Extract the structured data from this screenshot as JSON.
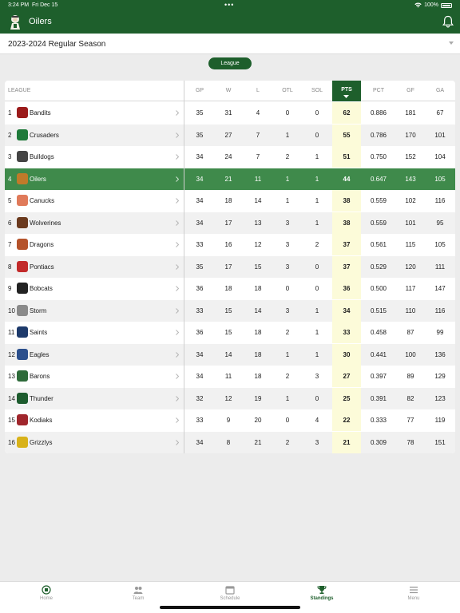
{
  "status_bar": {
    "time": "3:24 PM",
    "date": "Fri Dec 15",
    "battery": "100%"
  },
  "header": {
    "team_name": "Oilers"
  },
  "season": {
    "selected": "2023-2024 Regular Season"
  },
  "filter": {
    "label": "League"
  },
  "table": {
    "columns": [
      "LEAGUE",
      "GP",
      "W",
      "L",
      "OTL",
      "SOL",
      "PTS",
      "PCT",
      "GF",
      "GA"
    ],
    "sorted_column": "PTS",
    "selected_row": 3,
    "rows": [
      {
        "rank": "1",
        "team": "Bandits",
        "gp": "35",
        "w": "31",
        "l": "4",
        "otl": "0",
        "sol": "0",
        "pts": "62",
        "pct": "0.886",
        "gf": "181",
        "ga": "67",
        "logo_color": "#9b1b1b"
      },
      {
        "rank": "2",
        "team": "Crusaders",
        "gp": "35",
        "w": "27",
        "l": "7",
        "otl": "1",
        "sol": "0",
        "pts": "55",
        "pct": "0.786",
        "gf": "170",
        "ga": "101",
        "logo_color": "#1f7a3a"
      },
      {
        "rank": "3",
        "team": "Bulldogs",
        "gp": "34",
        "w": "24",
        "l": "7",
        "otl": "2",
        "sol": "1",
        "pts": "51",
        "pct": "0.750",
        "gf": "152",
        "ga": "104",
        "logo_color": "#444444"
      },
      {
        "rank": "4",
        "team": "Oilers",
        "gp": "34",
        "w": "21",
        "l": "11",
        "otl": "1",
        "sol": "1",
        "pts": "44",
        "pct": "0.647",
        "gf": "143",
        "ga": "105",
        "logo_color": "#c07a2a"
      },
      {
        "rank": "5",
        "team": "Canucks",
        "gp": "34",
        "w": "18",
        "l": "14",
        "otl": "1",
        "sol": "1",
        "pts": "38",
        "pct": "0.559",
        "gf": "102",
        "ga": "116",
        "logo_color": "#e07a5a"
      },
      {
        "rank": "6",
        "team": "Wolverines",
        "gp": "34",
        "w": "17",
        "l": "13",
        "otl": "3",
        "sol": "1",
        "pts": "38",
        "pct": "0.559",
        "gf": "101",
        "ga": "95",
        "logo_color": "#6b3a1e"
      },
      {
        "rank": "7",
        "team": "Dragons",
        "gp": "33",
        "w": "16",
        "l": "12",
        "otl": "3",
        "sol": "2",
        "pts": "37",
        "pct": "0.561",
        "gf": "115",
        "ga": "105",
        "logo_color": "#b5532b"
      },
      {
        "rank": "8",
        "team": "Pontiacs",
        "gp": "35",
        "w": "17",
        "l": "15",
        "otl": "3",
        "sol": "0",
        "pts": "37",
        "pct": "0.529",
        "gf": "120",
        "ga": "111",
        "logo_color": "#c22a2a"
      },
      {
        "rank": "9",
        "team": "Bobcats",
        "gp": "36",
        "w": "18",
        "l": "18",
        "otl": "0",
        "sol": "0",
        "pts": "36",
        "pct": "0.500",
        "gf": "117",
        "ga": "147",
        "logo_color": "#222222"
      },
      {
        "rank": "10",
        "team": "Storm",
        "gp": "33",
        "w": "15",
        "l": "14",
        "otl": "3",
        "sol": "1",
        "pts": "34",
        "pct": "0.515",
        "gf": "110",
        "ga": "116",
        "logo_color": "#8a8a8a"
      },
      {
        "rank": "11",
        "team": "Saints",
        "gp": "36",
        "w": "15",
        "l": "18",
        "otl": "2",
        "sol": "1",
        "pts": "33",
        "pct": "0.458",
        "gf": "87",
        "ga": "99",
        "logo_color": "#1d3a6b"
      },
      {
        "rank": "12",
        "team": "Eagles",
        "gp": "34",
        "w": "14",
        "l": "18",
        "otl": "1",
        "sol": "1",
        "pts": "30",
        "pct": "0.441",
        "gf": "100",
        "ga": "136",
        "logo_color": "#2b4f8c"
      },
      {
        "rank": "13",
        "team": "Barons",
        "gp": "34",
        "w": "11",
        "l": "18",
        "otl": "2",
        "sol": "3",
        "pts": "27",
        "pct": "0.397",
        "gf": "89",
        "ga": "129",
        "logo_color": "#2e6b3a"
      },
      {
        "rank": "14",
        "team": "Thunder",
        "gp": "32",
        "w": "12",
        "l": "19",
        "otl": "1",
        "sol": "0",
        "pts": "25",
        "pct": "0.391",
        "gf": "82",
        "ga": "123",
        "logo_color": "#1d5c2e"
      },
      {
        "rank": "15",
        "team": "Kodiaks",
        "gp": "33",
        "w": "9",
        "l": "20",
        "otl": "0",
        "sol": "4",
        "pts": "22",
        "pct": "0.333",
        "gf": "77",
        "ga": "119",
        "logo_color": "#a0262c"
      },
      {
        "rank": "16",
        "team": "Grizzlys",
        "gp": "34",
        "w": "8",
        "l": "21",
        "otl": "2",
        "sol": "3",
        "pts": "21",
        "pct": "0.309",
        "gf": "78",
        "ga": "151",
        "logo_color": "#d8b21a"
      }
    ]
  },
  "tabs": [
    {
      "label": "Home",
      "icon": "home-icon",
      "active": false
    },
    {
      "label": "Team",
      "icon": "team-icon",
      "active": false
    },
    {
      "label": "Schedule",
      "icon": "calendar-icon",
      "active": false
    },
    {
      "label": "Standings",
      "icon": "trophy-icon",
      "active": true
    },
    {
      "label": "Menu",
      "icon": "menu-icon",
      "active": false
    }
  ],
  "colors": {
    "brand_green": "#1e5f2c",
    "selected_row": "#3f8a4b",
    "pts_highlight": "#fcfbd9"
  }
}
